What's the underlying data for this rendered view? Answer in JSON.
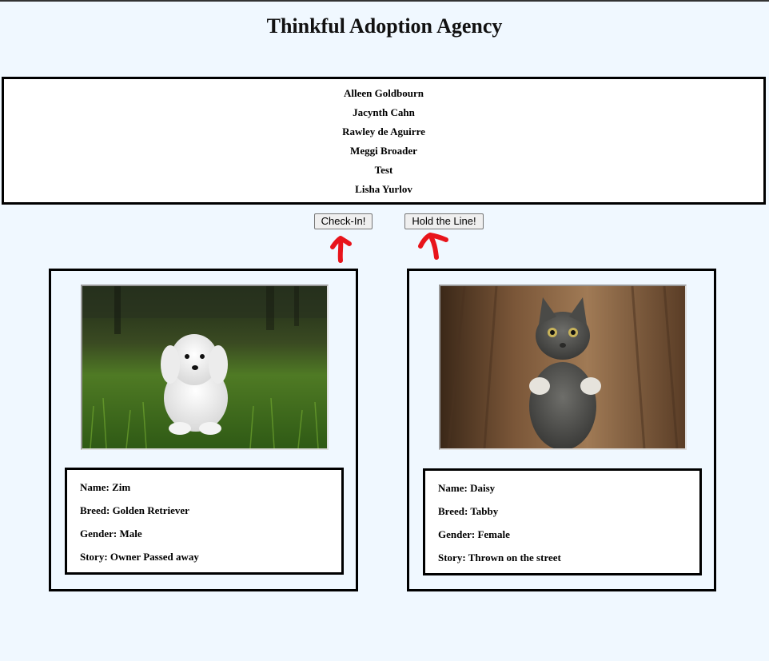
{
  "header": {
    "title": "Thinkful Adoption Agency"
  },
  "queue": {
    "people": [
      "Alleen Goldbourn",
      "Jacynth Cahn",
      "Rawley de Aguirre",
      "Meggi Broader",
      "Test",
      "Lisha Yurlov"
    ]
  },
  "buttons": {
    "checkin_label": "Check-In!",
    "hold_label": "Hold the Line!"
  },
  "annotation_color": "#e8141b",
  "pets": [
    {
      "animal": "dog",
      "name_label": "Name:",
      "name": "Zim",
      "breed_label": "Breed:",
      "breed": "Golden Retriever",
      "gender_label": "Gender:",
      "gender": "Male",
      "story_label": "Story:",
      "story": "Owner Passed away"
    },
    {
      "animal": "cat",
      "name_label": "Name:",
      "name": "Daisy",
      "breed_label": "Breed:",
      "breed": "Tabby",
      "gender_label": "Gender:",
      "gender": "Female",
      "story_label": "Story:",
      "story": "Thrown on the street"
    }
  ]
}
